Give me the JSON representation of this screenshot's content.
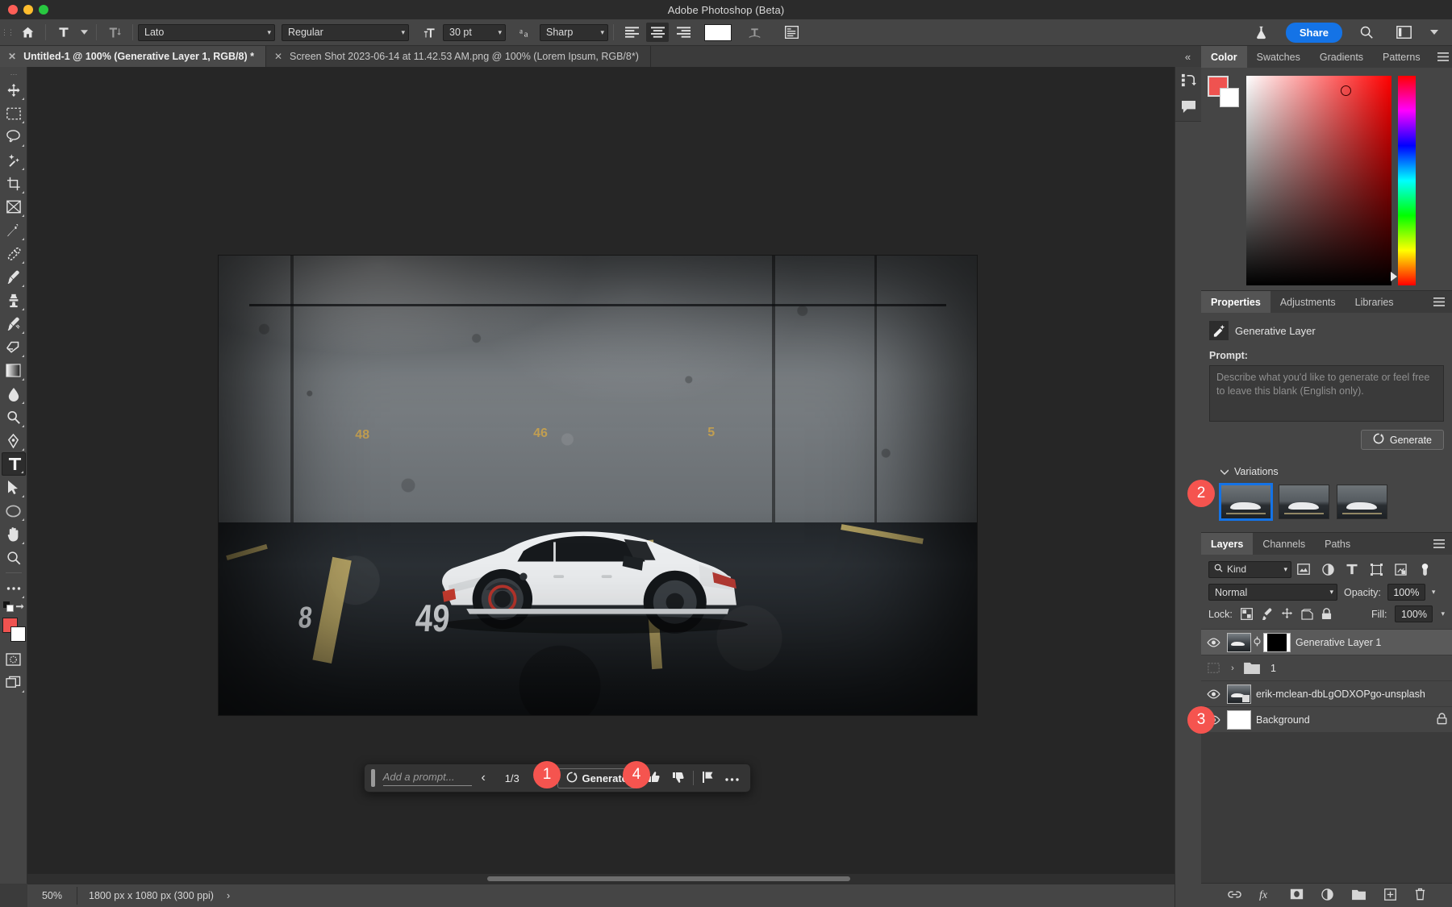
{
  "window": {
    "title": "Adobe Photoshop (Beta)"
  },
  "options_bar": {
    "home_icon": "home-icon",
    "tool_icon": "type-tool-icon",
    "orientation_icon": "text-orientation-icon",
    "font_family": "Lato",
    "font_style": "Regular",
    "font_size": "30 pt",
    "anti_alias": "Sharp",
    "align": [
      "align-left",
      "align-center",
      "align-right"
    ],
    "align_active_index": 1,
    "text_color": "#ffffff",
    "warp_icon": "warp-text-icon",
    "panels_icon": "character-panel-icon"
  },
  "header_right": {
    "beta_icon": "flask-icon",
    "share_label": "Share",
    "search_icon": "search-icon",
    "workspace_icon": "workspace-icon",
    "chevron_icon": "chevron-down-icon"
  },
  "tabs": [
    {
      "label": "Untitled-1 @ 100% (Generative Layer 1, RGB/8) *",
      "active": true
    },
    {
      "label": "Screen Shot 2023-06-14 at 11.42.53 AM.png @ 100% (Lorem Ipsum, RGB/8*)",
      "active": false
    }
  ],
  "tools": [
    {
      "name": "move-tool",
      "icon": "move-icon"
    },
    {
      "name": "rectangular-marquee-tool",
      "icon": "marquee-icon"
    },
    {
      "name": "lasso-tool",
      "icon": "lasso-icon"
    },
    {
      "name": "object-selection-tool",
      "icon": "magic-wand-icon"
    },
    {
      "name": "crop-tool",
      "icon": "crop-icon"
    },
    {
      "name": "frame-tool",
      "icon": "frame-icon"
    },
    {
      "name": "eyedropper-tool",
      "icon": "eyedropper-icon"
    },
    {
      "name": "healing-brush-tool",
      "icon": "healing-brush-icon"
    },
    {
      "name": "brush-tool",
      "icon": "brush-icon"
    },
    {
      "name": "clone-stamp-tool",
      "icon": "stamp-icon"
    },
    {
      "name": "history-brush-tool",
      "icon": "history-brush-icon"
    },
    {
      "name": "eraser-tool",
      "icon": "eraser-icon"
    },
    {
      "name": "gradient-tool",
      "icon": "gradient-icon"
    },
    {
      "name": "blur-tool",
      "icon": "blur-drop-icon"
    },
    {
      "name": "dodge-tool",
      "icon": "dodge-icon"
    },
    {
      "name": "pen-tool",
      "icon": "pen-icon"
    },
    {
      "name": "type-tool",
      "icon": "type-icon",
      "selected": true
    },
    {
      "name": "path-selection-tool",
      "icon": "arrow-cursor-icon"
    },
    {
      "name": "ellipse-tool",
      "icon": "ellipse-icon"
    },
    {
      "name": "hand-tool",
      "icon": "hand-icon"
    },
    {
      "name": "zoom-tool",
      "icon": "zoom-icon"
    },
    {
      "name": "edit-toolbar",
      "icon": "ellipsis-icon"
    }
  ],
  "tool_footer": {
    "default_colors_icon": "default-colors-icon",
    "swap_colors_icon": "swap-colors-icon",
    "foreground_color": "#ef5350",
    "background_color": "#ffffff",
    "quick_mask_icon": "quick-mask-icon",
    "screen_mode_icon": "screen-mode-icon"
  },
  "canvas": {
    "document_wall_numbers": [
      "48",
      "46",
      "5"
    ],
    "floor_numbers": [
      "8",
      "49"
    ]
  },
  "contextual_taskbar": {
    "prompt_placeholder": "Add a prompt...",
    "prev_icon": "chevron-left-icon",
    "variation_count": "1/3",
    "next_icon": "chevron-right-icon",
    "generate_label": "Generate",
    "generate_icon": "generate-sparkle-icon",
    "thumbs_up_icon": "thumbs-up-icon",
    "thumbs_down_icon": "thumbs-down-icon",
    "flag_icon": "report-flag-icon",
    "more_icon": "more-options-icon"
  },
  "status_bar": {
    "zoom": "50%",
    "doc_size": "1800 px x 1080 px (300 ppi)",
    "chevron": "chevron-right-icon"
  },
  "icon_rail": [
    {
      "name": "history-icon"
    },
    {
      "name": "comments-icon"
    }
  ],
  "collapse_icon": "collapse-panels-icon",
  "color_panel": {
    "tabs": [
      "Color",
      "Swatches",
      "Gradients",
      "Patterns"
    ],
    "active_tab": "Color",
    "menu_icon": "panel-menu-icon",
    "foreground_color": "#ef5350",
    "background_color": "#ffffff"
  },
  "properties_panel": {
    "tabs": [
      "Properties",
      "Adjustments",
      "Libraries"
    ],
    "active_tab": "Properties",
    "menu_icon": "panel-menu-icon",
    "layer_type": "Generative Layer",
    "layer_type_icon": "generative-layer-icon",
    "mask_icon": "layer-mask-icon",
    "prompt_label": "Prompt:",
    "prompt_placeholder": "Describe what you'd like to generate or feel free to leave this blank (English only).",
    "prompt_value": "",
    "generate_label": "Generate",
    "generate_icon": "generate-sparkle-icon",
    "variations_label": "Variations",
    "variations_chevron": "chevron-down-icon",
    "variations": [
      {
        "name": "variation-1",
        "selected": true
      },
      {
        "name": "variation-2",
        "selected": false
      },
      {
        "name": "variation-3",
        "selected": false
      }
    ],
    "selection_color": "#1473e6"
  },
  "layers_panel": {
    "tabs": [
      "Layers",
      "Channels",
      "Paths"
    ],
    "active_tab": "Layers",
    "menu_icon": "panel-menu-icon",
    "filter_kind": "Kind",
    "filter_search_icon": "search-icon",
    "filter_icons": [
      "pixel-filter-icon",
      "adjustment-filter-icon",
      "type-filter-icon",
      "shape-filter-icon",
      "smart-object-filter-icon"
    ],
    "filter_toggle_icon": "filter-toggle-icon",
    "blend_mode": "Normal",
    "opacity_label": "Opacity:",
    "opacity_value": "100%",
    "lock_label": "Lock:",
    "lock_icons": [
      "lock-transparency-icon",
      "lock-image-icon",
      "lock-position-icon",
      "lock-artboard-icon",
      "lock-all-icon"
    ],
    "fill_label": "Fill:",
    "fill_value": "100%",
    "layers": [
      {
        "name": "Generative Layer 1",
        "visible": true,
        "selected": true,
        "has_mask": true,
        "type": "generative"
      },
      {
        "name": "1",
        "visible": false,
        "selected": false,
        "type": "group"
      },
      {
        "name": "erik-mclean-dbLgODXOPgo-unsplash",
        "visible": true,
        "selected": false,
        "type": "smart-object"
      },
      {
        "name": "Background",
        "visible": true,
        "selected": false,
        "type": "background",
        "locked": true
      }
    ],
    "footer_icons": [
      "link-layers-icon",
      "layer-style-icon",
      "add-mask-icon",
      "adjustment-layer-icon",
      "new-group-icon",
      "new-layer-icon",
      "delete-layer-icon"
    ]
  },
  "badges": [
    {
      "label": "1",
      "target": "contextual-taskbar-variation-count"
    },
    {
      "label": "4",
      "target": "contextual-taskbar-generate"
    },
    {
      "label": "2",
      "target": "properties-variations"
    },
    {
      "label": "3",
      "target": "layers-generative-layer"
    }
  ],
  "colors": {
    "accent_blue": "#1473e6",
    "badge_red": "#f5544f",
    "panel_bg": "#454545",
    "canvas_bg": "#262626"
  }
}
